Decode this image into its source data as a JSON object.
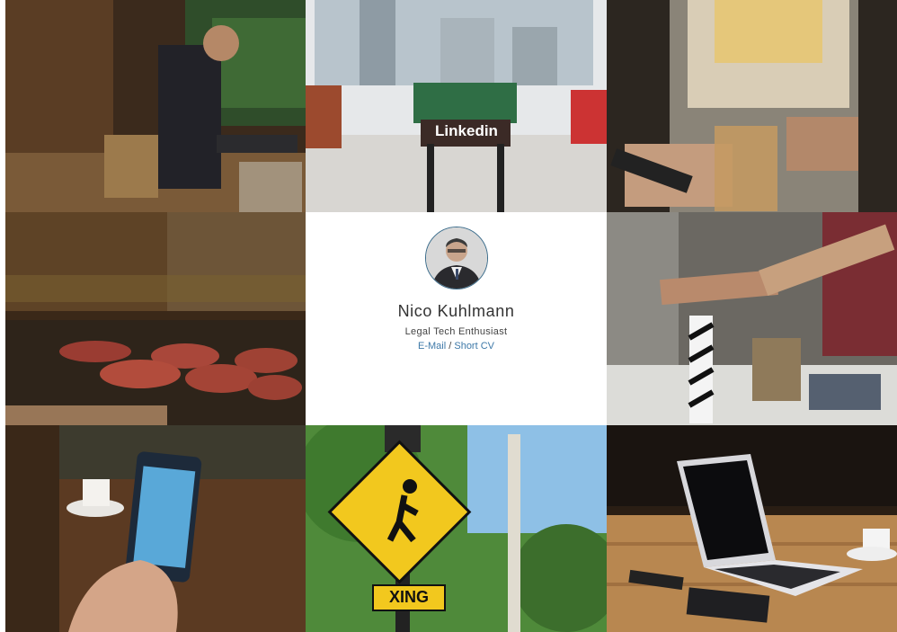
{
  "profile": {
    "name": "Nico Kuhlmann",
    "role": "Legal Tech Enthusiast",
    "email_label": "E-Mail",
    "separator": "/",
    "cv_label": "Short CV"
  },
  "photos": {
    "foosball_brand": "Linkedin",
    "sign_text": "XING"
  },
  "colors": {
    "link": "#3e79a8",
    "avatar_ring": "#3a6b8a"
  }
}
